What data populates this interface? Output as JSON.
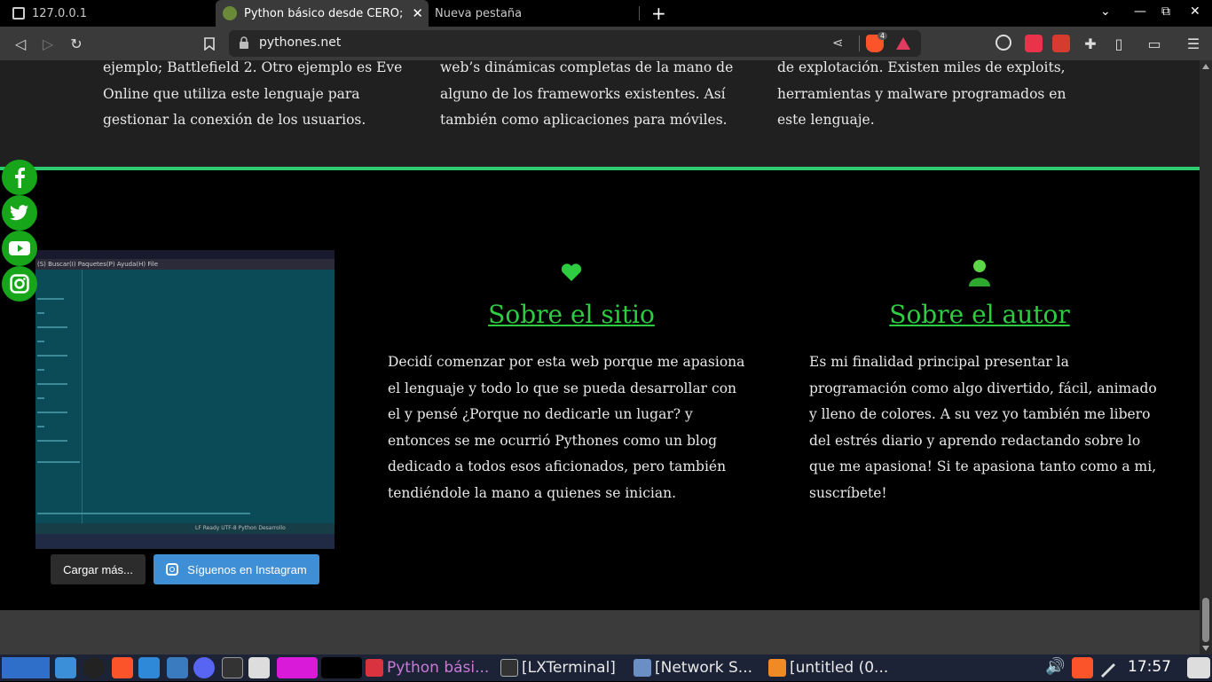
{
  "browser": {
    "tabs": [
      {
        "label": "127.0.0.1",
        "active": false
      },
      {
        "label": "Python básico desde CERO;",
        "active": true
      },
      {
        "label": "Nueva pestaña",
        "active": false
      }
    ],
    "url": "pythones.net",
    "brave_badge": "4"
  },
  "page": {
    "top_columns": [
      "ejemplo; Battlefield 2.  Otro ejemplo es Eve Online que utiliza este lenguaje para gestionar la conexión de los usuarios.",
      "web’s dinámicas completas de la mano de alguno de los frameworks existentes. Así también como aplicaciones para móviles.",
      "de explotación. Existen miles de exploits, herramientas y malware programados en este lenguaje."
    ],
    "instagram": {
      "menu_text": "(S)  Buscar(I)  Paquetes(P)  Ayuda(H)  File",
      "status_text": "LF   Ready   UTF-8   Python   Desarrollo",
      "load_more": "Cargar más...",
      "follow": "Síguenos en Instagram"
    },
    "about_site": {
      "title": "Sobre el sitio",
      "text": "Decidí comenzar por esta web porque me apasiona el lenguaje y todo lo que se pueda desarrollar con el y pensé ¿Porque no dedicarle un lugar? y entonces se me ocurrió Pythones como un blog dedicado a todos esos aficionados, pero también tendiéndole la mano a quienes se inician."
    },
    "about_author": {
      "title": "Sobre el autor",
      "text": "Es mi finalidad principal presentar la programación como algo divertido, fácil, animado y lleno de colores. A su vez yo también me libero del estrés diario y aprendo redactando sobre lo que me apasiona! Si te apasiona tanto como a mi, suscríbete!"
    },
    "social": [
      "f",
      "t",
      "▶",
      "ig"
    ]
  },
  "taskbar": {
    "items": [
      {
        "label": "Python bási...",
        "color": "#d9333f"
      },
      {
        "label": "[LXTerminal]",
        "color": "#333"
      },
      {
        "label": "[Network S...",
        "color": "#6a8fc4"
      },
      {
        "label": "[untitled (0...",
        "color": "#f08a24"
      }
    ],
    "clock": "17:57"
  },
  "colors": {
    "accent": "#2ecc40",
    "brave": "#fb542b"
  }
}
